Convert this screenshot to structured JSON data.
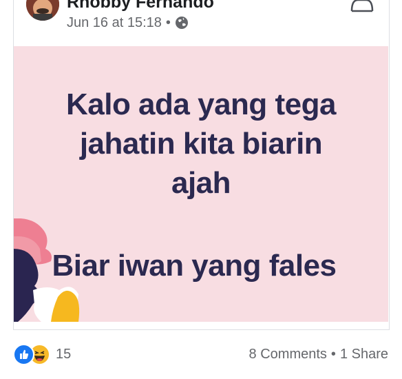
{
  "post": {
    "author_name": "Rhobby Fernando",
    "timestamp": "Jun 16 at 15:18",
    "separator": "•",
    "privacy_icon": "globe-icon",
    "image": {
      "line_1": "Kalo ada yang tega",
      "line_2": "jahatin kita biarin",
      "line_3": "ajah",
      "line_4": "Biar iwan yang fales",
      "background_color": "#f8dde2",
      "text_color": "#2b2950"
    }
  },
  "footer": {
    "reaction_icons": [
      "like-icon",
      "haha-icon"
    ],
    "reaction_count": "15",
    "comments": "8 Comments",
    "separator": "•",
    "shares": "1 Share"
  }
}
